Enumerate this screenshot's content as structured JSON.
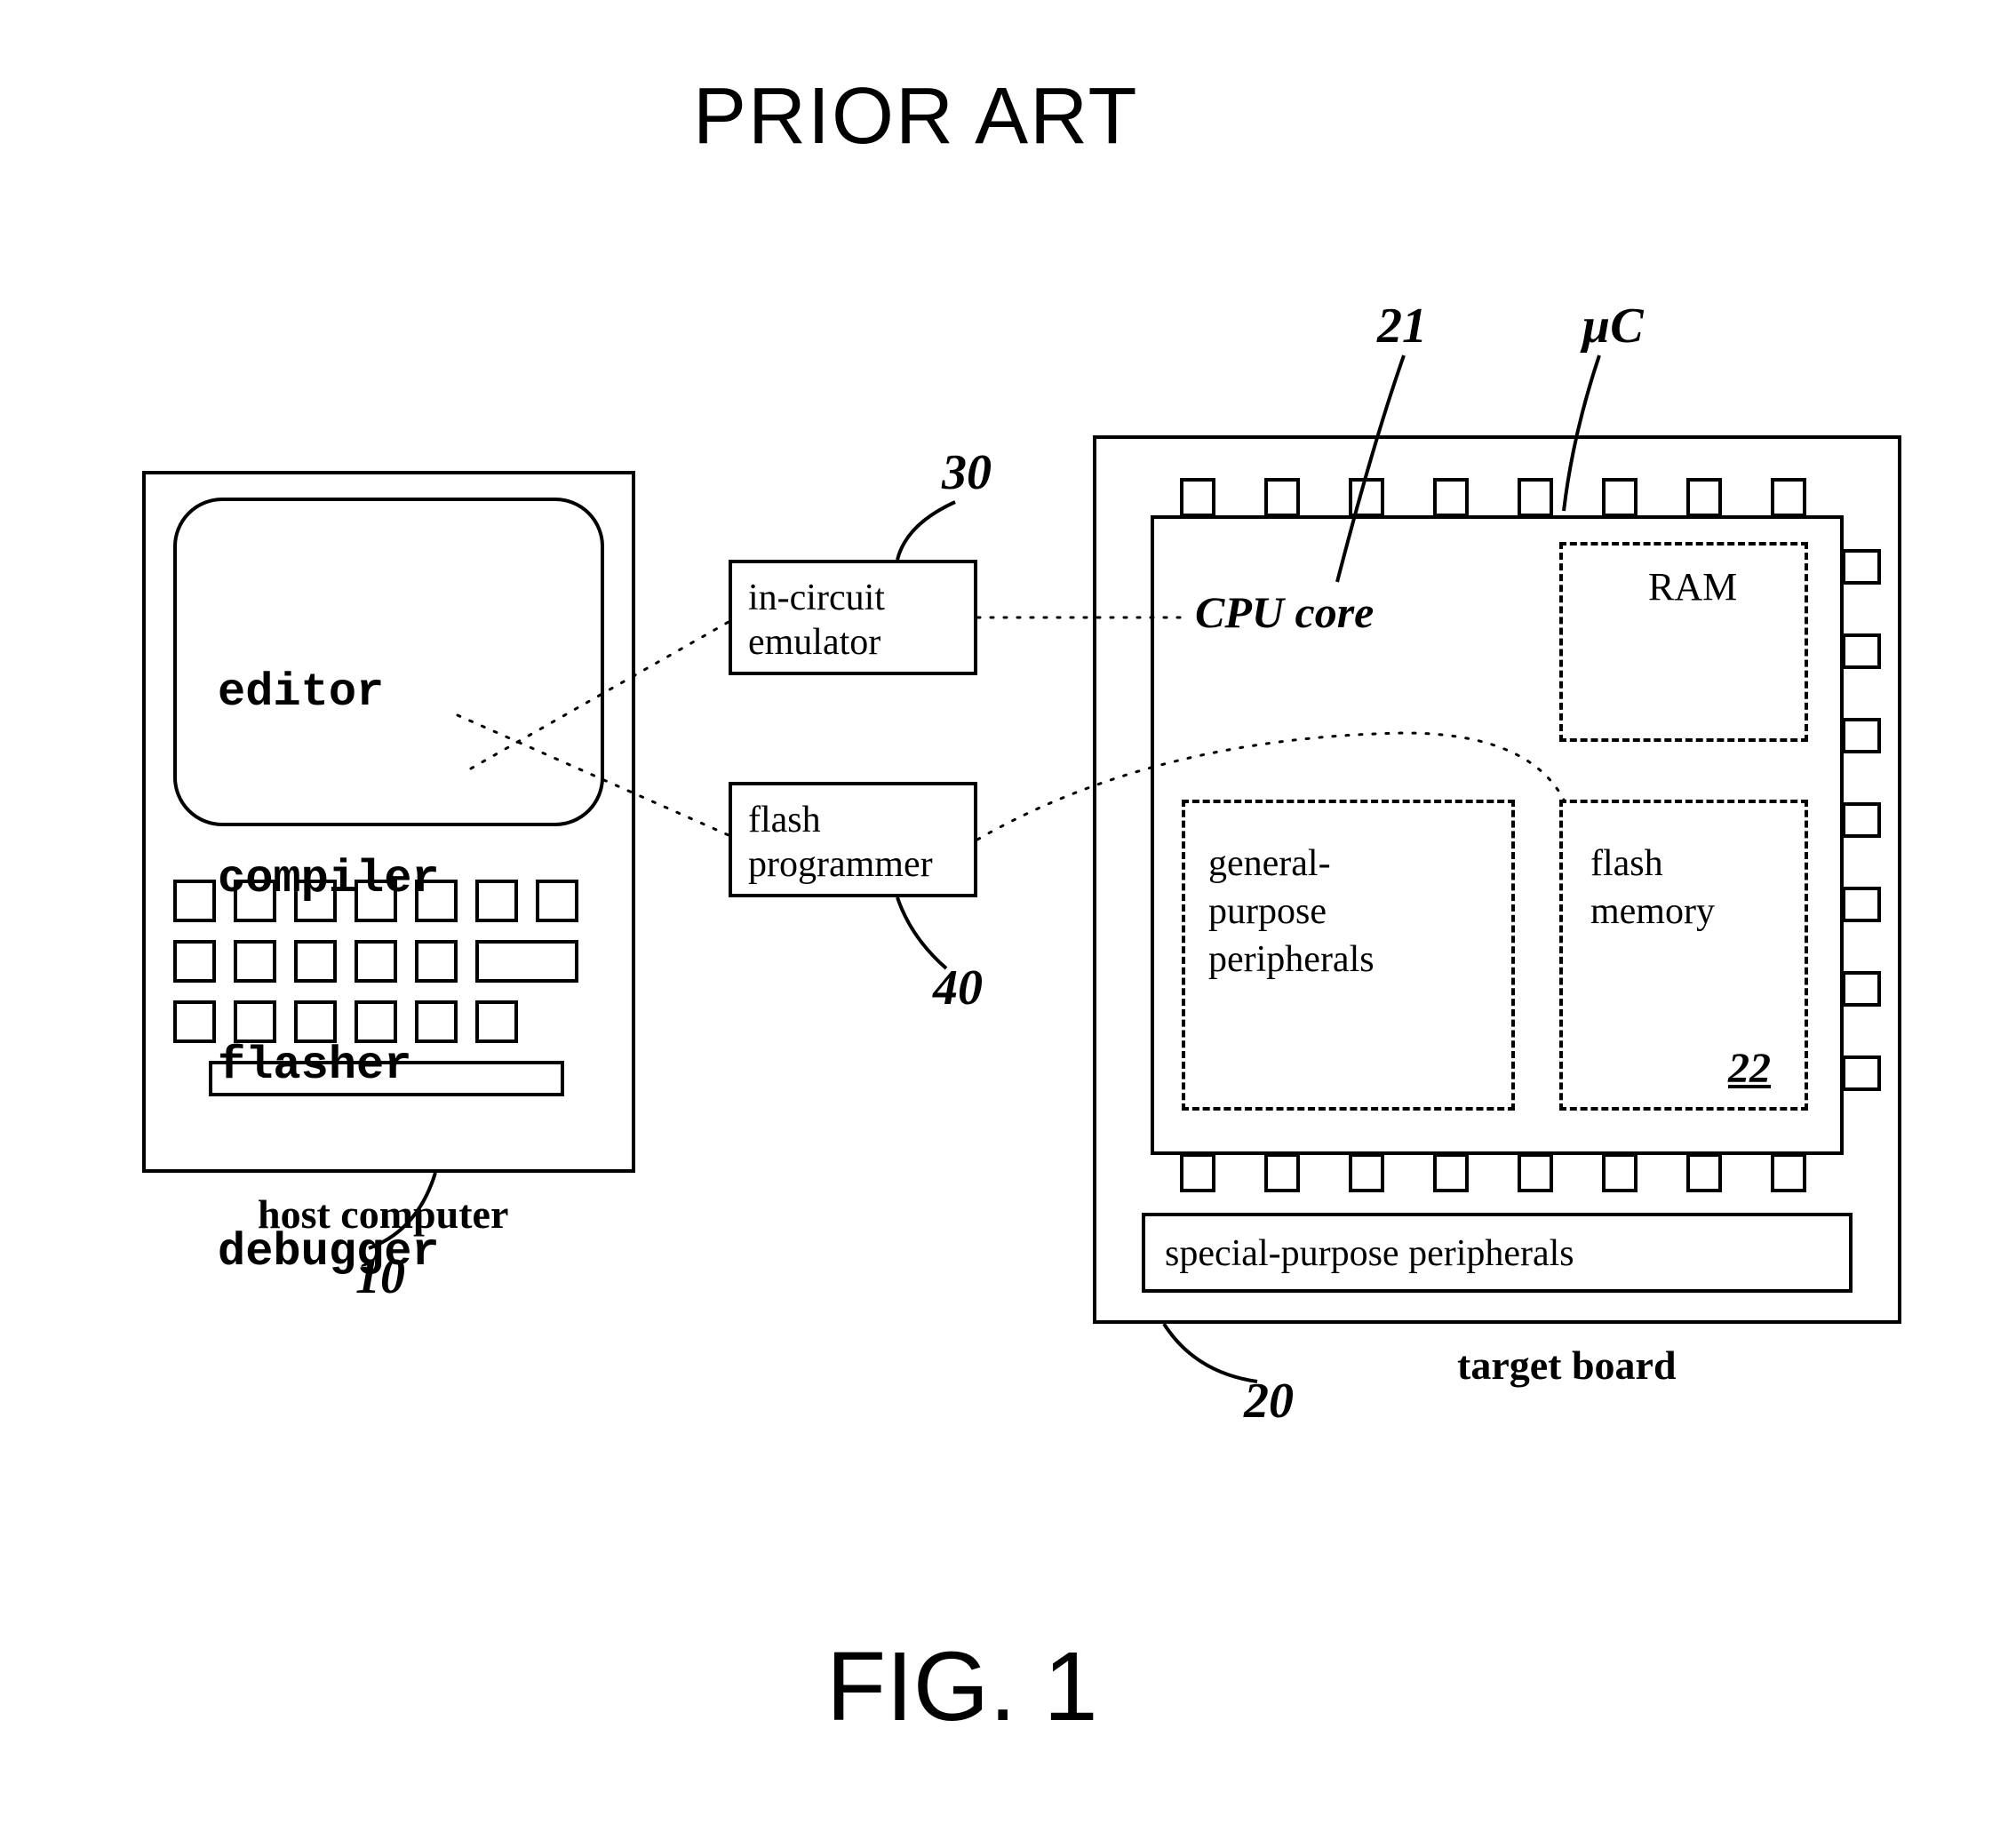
{
  "title": "PRIOR ART",
  "figure_label": "FIG. 1",
  "host": {
    "label": "host computer",
    "ref": "10",
    "screen_lines": [
      "editor",
      "compiler",
      "flasher",
      "debugger"
    ]
  },
  "emulator": {
    "line1": "in-circuit",
    "line2": "emulator",
    "ref": "30"
  },
  "programmer": {
    "line1": "flash",
    "line2": "programmer",
    "ref": "40"
  },
  "target": {
    "label": "target board",
    "ref": "20",
    "chip_label": "µC",
    "cpu_label": "CPU core",
    "cpu_ref": "21",
    "ram_label": "RAM",
    "gp_label": "general-\npurpose\nperipherals",
    "flash_label": "flash\nmemory",
    "flash_ref": "22",
    "sp_label": "special-purpose peripherals"
  }
}
